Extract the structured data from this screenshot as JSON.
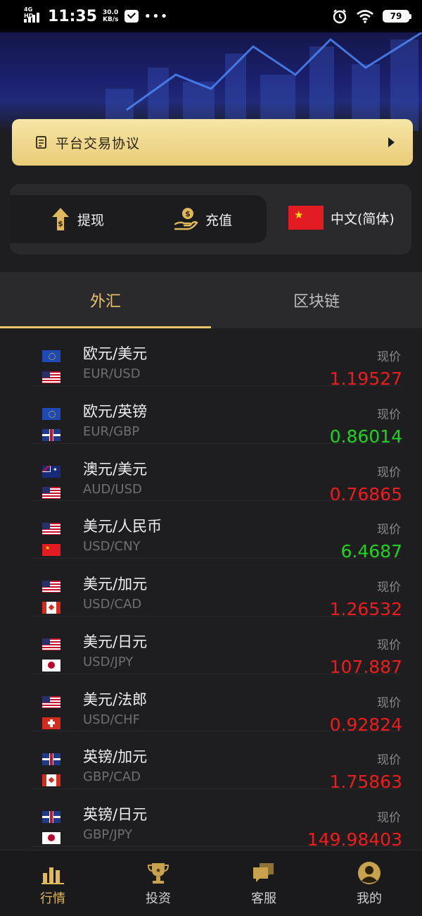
{
  "status_bar": {
    "network": "4G HD",
    "time": "11:35",
    "speed_value": "30.0",
    "speed_unit": "KB/s",
    "battery": "79"
  },
  "agreement": {
    "label": "平台交易协议",
    "icon": "document-icon"
  },
  "actions": {
    "withdraw_label": "提现",
    "deposit_label": "充值",
    "language_label": "中文(简体)"
  },
  "tabs": [
    {
      "label": "外汇",
      "active": true
    },
    {
      "label": "区块链",
      "active": false
    }
  ],
  "price_label": "现价",
  "quotes": [
    {
      "name": "欧元/美元",
      "code": "EUR/USD",
      "price": "1.19527",
      "trend": "down",
      "flags": [
        "eu",
        "us"
      ]
    },
    {
      "name": "欧元/英镑",
      "code": "EUR/GBP",
      "price": "0.86014",
      "trend": "up",
      "flags": [
        "eu",
        "gb"
      ]
    },
    {
      "name": "澳元/美元",
      "code": "AUD/USD",
      "price": "0.76865",
      "trend": "down",
      "flags": [
        "au",
        "us"
      ]
    },
    {
      "name": "美元/人民币",
      "code": "USD/CNY",
      "price": "6.4687",
      "trend": "up",
      "flags": [
        "us",
        "cn"
      ]
    },
    {
      "name": "美元/加元",
      "code": "USD/CAD",
      "price": "1.26532",
      "trend": "down",
      "flags": [
        "us",
        "ca"
      ]
    },
    {
      "name": "美元/日元",
      "code": "USD/JPY",
      "price": "107.887",
      "trend": "down",
      "flags": [
        "us",
        "jp"
      ]
    },
    {
      "name": "美元/法郎",
      "code": "USD/CHF",
      "price": "0.92824",
      "trend": "down",
      "flags": [
        "us",
        "ch"
      ]
    },
    {
      "name": "英镑/加元",
      "code": "GBP/CAD",
      "price": "1.75863",
      "trend": "down",
      "flags": [
        "gb",
        "ca"
      ]
    },
    {
      "name": "英镑/日元",
      "code": "GBP/JPY",
      "price": "149.98403",
      "trend": "down",
      "flags": [
        "gb",
        "jp"
      ]
    }
  ],
  "colors": {
    "up": "#1ed31e",
    "down": "#ee1c1c",
    "gold": "#e9c46a"
  },
  "bottom_nav": [
    {
      "label": "行情",
      "icon": "chart-bar-icon",
      "active": true
    },
    {
      "label": "投资",
      "icon": "trophy-icon",
      "active": false
    },
    {
      "label": "客服",
      "icon": "chat-bubbles-icon",
      "active": false
    },
    {
      "label": "我的",
      "icon": "user-avatar-icon",
      "active": false
    }
  ]
}
